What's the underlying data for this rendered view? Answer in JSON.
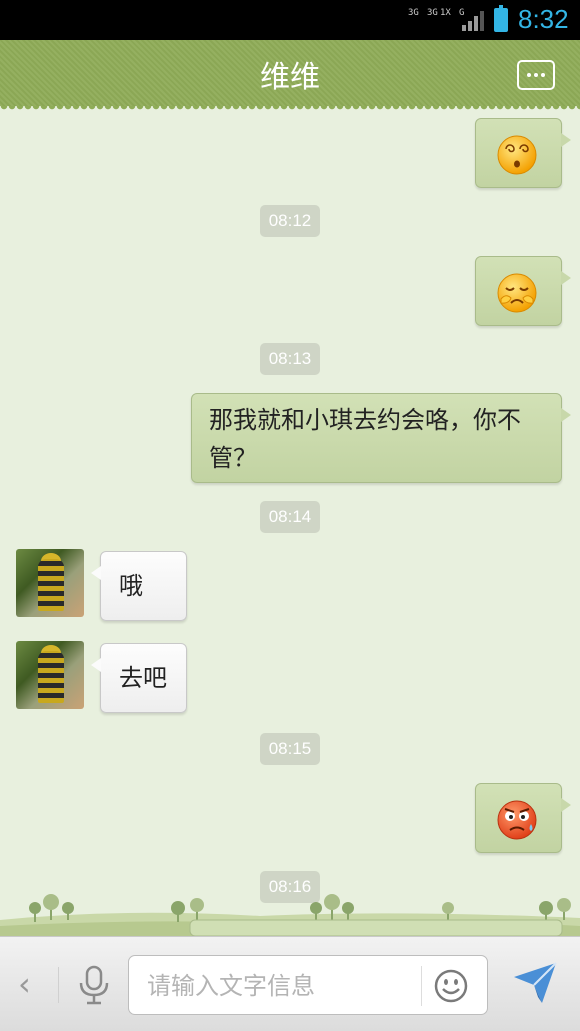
{
  "status_bar": {
    "net_labels": [
      "3G",
      "3G",
      "1X",
      "G"
    ],
    "time": "8:32",
    "battery_color": "#33b5e5"
  },
  "header": {
    "title": "维维",
    "menu_icon": "more-icon"
  },
  "messages": [
    {
      "type": "sticker",
      "side": "out",
      "emoji": "dizzy-face-emoji"
    },
    {
      "type": "time",
      "text": "08:12"
    },
    {
      "type": "sticker",
      "side": "out",
      "emoji": "embarrassed-face-emoji"
    },
    {
      "type": "time",
      "text": "08:13"
    },
    {
      "type": "text",
      "side": "out",
      "text": "那我就和小琪去约会咯，你不管？"
    },
    {
      "type": "time",
      "text": "08:14"
    },
    {
      "type": "text",
      "side": "in",
      "text": "哦"
    },
    {
      "type": "text",
      "side": "in",
      "text": "去吧"
    },
    {
      "type": "time",
      "text": "08:15"
    },
    {
      "type": "sticker",
      "side": "out",
      "emoji": "sweating-angry-face-emoji"
    },
    {
      "type": "time",
      "text": "08:16"
    }
  ],
  "input_bar": {
    "placeholder": "请输入文字信息",
    "value": "",
    "back_icon": "chevron-left-icon",
    "voice_icon": "microphone-icon",
    "emoji_icon": "smiley-icon",
    "send_icon": "send-icon"
  },
  "colors": {
    "header_bg": "#8fac58",
    "chat_bg": "#e8f0de",
    "outgoing_bubble": "#c8d8aa",
    "incoming_bubble": "#f7f7f7",
    "send_accent": "#4a8fd6"
  }
}
